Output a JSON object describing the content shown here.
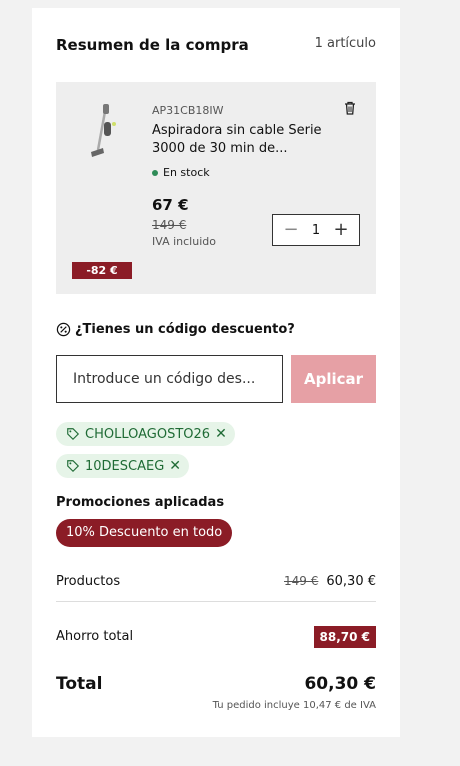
{
  "summary": {
    "title": "Resumen de la compra",
    "count": "1 artículo"
  },
  "product": {
    "sku": "AP31CB18IW",
    "name": "Aspiradora sin cable Serie 3000 de 30 min de...",
    "stock": "En stock",
    "price": "67 €",
    "old_price": "149 €",
    "vat_note": "IVA incluido",
    "quantity": "1",
    "discount_badge": "-82 €"
  },
  "coupon": {
    "question": "¿Tienes un código descuento?",
    "placeholder": "Introduce un código des...",
    "apply_label": "Aplicar",
    "applied": [
      "CHOLLOAGOSTO26",
      "10DESCAEG"
    ]
  },
  "promotions": {
    "heading": "Promociones aplicadas",
    "badge": "10% Descuento en todo"
  },
  "totals": {
    "products_label": "Productos",
    "products_old": "149 €",
    "products_value": "60,30 €",
    "saving_label": "Ahorro total",
    "saving_value": "88,70 €",
    "total_label": "Total",
    "total_value": "60,30 €",
    "vat_text": "Tu pedido incluye 10,47 € de IVA"
  },
  "colors": {
    "accent": "#8b1c26",
    "apply_button": "#e6a0a5",
    "chip_bg": "#e6f4e8",
    "chip_text": "#1f6b35",
    "stock_dot": "#2e8b57"
  }
}
